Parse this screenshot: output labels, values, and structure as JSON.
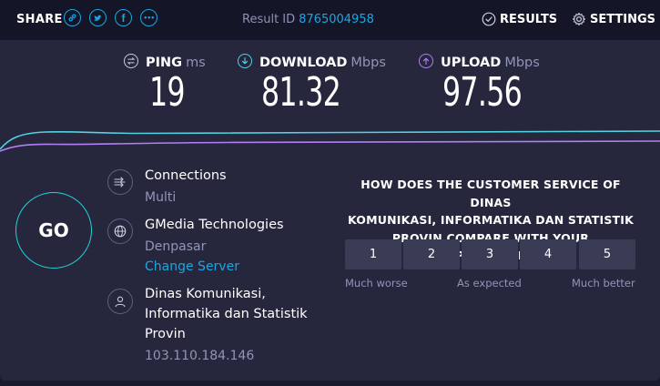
{
  "header": {
    "share_label": "SHARE",
    "share_buttons": [
      {
        "icon": "link-icon",
        "glyph": ""
      },
      {
        "icon": "twitter-icon",
        "glyph": ""
      },
      {
        "icon": "facebook-icon",
        "glyph": "f"
      },
      {
        "icon": "more-icon",
        "glyph": "•••"
      }
    ],
    "result_id_label": "Result ID",
    "result_id": "8765004958",
    "results_label": "RESULTS",
    "settings_label": "SETTINGS"
  },
  "metrics": {
    "ping": {
      "label": "PING",
      "unit": "ms",
      "value": "19"
    },
    "download": {
      "label": "DOWNLOAD",
      "unit": "Mbps",
      "value": "81.32"
    },
    "upload": {
      "label": "UPLOAD",
      "unit": "Mbps",
      "value": "97.56"
    }
  },
  "go_label": "GO",
  "server": {
    "connections_title": "Connections",
    "connections_mode": "Multi",
    "host_name": "GMedia Technologies",
    "host_location": "Denpasar",
    "change_server": "Change Server",
    "isp_line1": "Dinas Komunikasi,",
    "isp_line2": "Informatika dan Statistik",
    "isp_line3": "Provin",
    "ip": "103.110.184.146"
  },
  "survey": {
    "question_line1": "HOW DOES THE CUSTOMER SERVICE OF DINAS",
    "question_line2": "KOMUNIKASI, INFORMATIKA DAN STATISTIK",
    "question_line3": "PROVIN COMPARE WITH YOUR EXPECTATIONS?",
    "options": [
      "1",
      "2",
      "3",
      "4",
      "5"
    ],
    "label_low": "Much worse",
    "label_mid": "As expected",
    "label_high": "Much better"
  },
  "colors": {
    "accent": "#1ea5e0",
    "download": "#4fd3e0",
    "upload": "#b27ef5",
    "background": "#1a1a2e",
    "panel": "#26273d"
  }
}
